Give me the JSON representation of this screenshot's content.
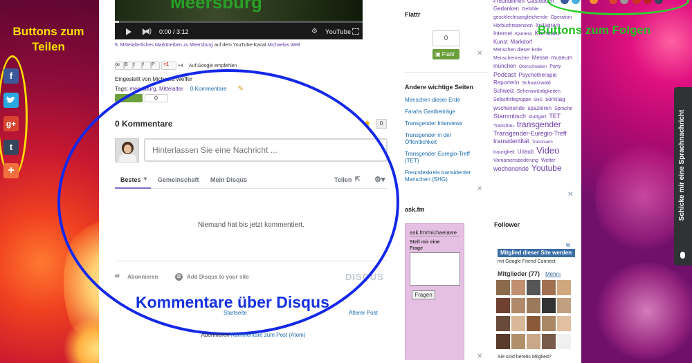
{
  "annotations": {
    "share_label": "Buttons zum\nTeilen",
    "follow_label": "Buttons zum Folgen",
    "comments_label": "Kommentare über Disqus"
  },
  "video": {
    "title_overlay": "Meersburg",
    "time": "0:00 / 3:12",
    "brand": "YouTube",
    "caption_link": "8. Mittelalterliches Markttreiben zu Meersburg",
    "caption_mid": " auf dem YouTube-Kanal ",
    "caption_channel": "Michaelas Welt"
  },
  "share_row": {
    "plus_count": "+4",
    "gplus_label": "+1",
    "recommend": "Auf Google empfehlen"
  },
  "post": {
    "author_line": "Eingestellt von Michaela Weffer",
    "tags_label": "Tags: ",
    "tag1": "meersburg",
    "tag2": "Mittelalter",
    "comments_link": "0 Kommentare",
    "flattr_count": "0"
  },
  "disqus": {
    "count_title": "0 Kommentare",
    "star_count": "0",
    "input_placeholder": "Hinterlassen Sie eine Nachricht ...",
    "tabs": [
      "Bestes",
      "Gemeinschaft",
      "Mein Disqus"
    ],
    "share": "Teilen",
    "empty": "Niemand hat bis jetzt kommentiert.",
    "subscribe": "Abonnieren",
    "add": "Add Disqus to your site",
    "brand": "DISQUS"
  },
  "footer": {
    "home": "Startseite",
    "older": "Älterer Post",
    "subscribe_prefix": "Abonnieren ",
    "subscribe_link": "Kommentare zum Post (Atom)"
  },
  "flattr": {
    "title": "Flattr",
    "count": "0",
    "button": "Flattr"
  },
  "pages": {
    "title": "Andere wichtige Seiten",
    "items": [
      "Menschen dieser Erde",
      "Farahs Gastbeiträge",
      "Transgender Interviews",
      "Transgender in der Öffentlichkeit",
      "Transgender-Euregio-Treff (TET)",
      "Freundeskreis transidenter Menschen (SHG)"
    ]
  },
  "askfm": {
    "title": "ask.fm",
    "url": "ask.fm/michaelawe",
    "prompt": "Stell mir eine Frage",
    "button": "Fragen"
  },
  "labels": {
    "words": [
      [
        "Freundinnen",
        "8"
      ],
      [
        "Gästebuch",
        "8"
      ],
      [
        "Gedanken",
        "8"
      ],
      [
        "Gefühle",
        "7"
      ],
      [
        "geschlechtsangleichende",
        "7"
      ],
      [
        "Operation",
        "7"
      ],
      [
        "Hörbuchrezension",
        "7"
      ],
      [
        "Instagram",
        "8"
      ],
      [
        "Internet",
        "8"
      ],
      [
        "Kamera",
        "7"
      ],
      [
        "Konstanz",
        "9"
      ],
      [
        "Kunst",
        "8"
      ],
      [
        "Markdorf",
        "8"
      ],
      [
        "Menschen dieser Erde",
        "7"
      ],
      [
        "Menschenrechte",
        "7"
      ],
      [
        "Messe",
        "8"
      ],
      [
        "museum",
        "8"
      ],
      [
        "münchen",
        "8"
      ],
      [
        "Oberschwaben",
        "6"
      ],
      [
        "Party",
        "7"
      ],
      [
        "Podcast",
        "9"
      ],
      [
        "Psychotherapie",
        "8"
      ],
      [
        "Reporterin",
        "8"
      ],
      [
        "Schwarzwald",
        "7"
      ],
      [
        "Schweiz",
        "8"
      ],
      [
        "Sehenswürdigkeiten",
        "7"
      ],
      [
        "Selbsthilfegruppe",
        "7"
      ],
      [
        "SHG",
        "6"
      ],
      [
        "sonntag",
        "8"
      ],
      [
        "wochenende",
        "8"
      ],
      [
        "spazieren",
        "8"
      ],
      [
        "Sprache",
        "7"
      ],
      [
        "Stammtisch",
        "9"
      ],
      [
        "stuttgart",
        "7"
      ],
      [
        "TET",
        "9"
      ],
      [
        "Transfrau",
        "7"
      ],
      [
        "transgender",
        "12"
      ],
      [
        "Transgender-Euregio-Treff",
        "9"
      ],
      [
        "transidentität",
        "9"
      ],
      [
        "Transmann",
        "6"
      ],
      [
        "traurigkeit",
        "7"
      ],
      [
        "Urlaub",
        "8"
      ],
      [
        "Video",
        "13"
      ],
      [
        "Vornamensänderung",
        "7"
      ],
      [
        "Wetter",
        "7"
      ],
      [
        "wochenende",
        "9"
      ],
      [
        "Youtube",
        "12"
      ]
    ]
  },
  "follower": {
    "title": "Follower",
    "join": "Mitglied dieser Site werden",
    "join_sub": "mit Google Friend Connect",
    "members": "Mitglieder (77)",
    "more": "Mehr»",
    "already": "Sie sind bereits Mitglied?"
  },
  "voice": {
    "label": "Schicke mir eine Sprachnachricht"
  }
}
